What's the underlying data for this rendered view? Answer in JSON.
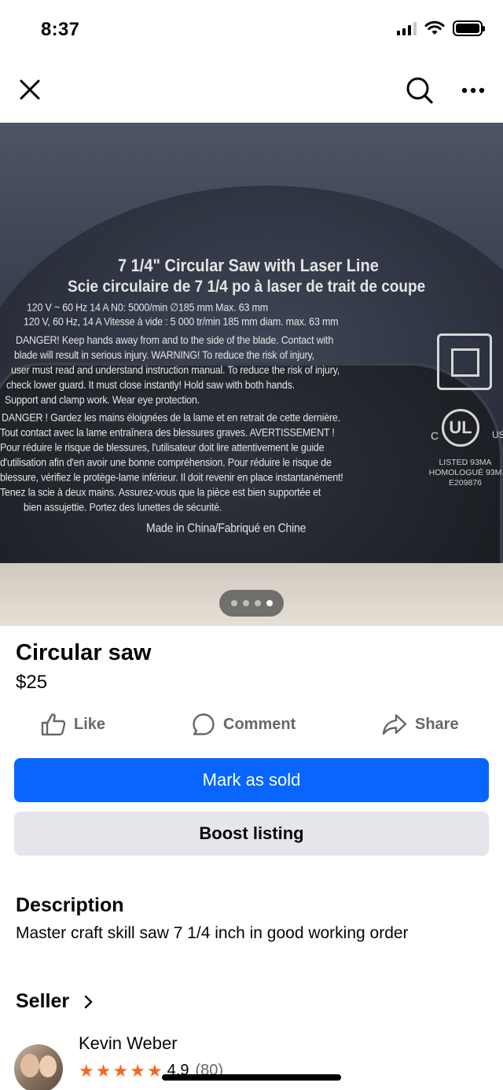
{
  "status_bar": {
    "time": "8:37"
  },
  "nav": {
    "close_icon": "close-icon",
    "search_icon": "search-icon",
    "more_icon": "more-icon"
  },
  "photo": {
    "label_lines": [
      "7 1/4\" Circular Saw with Laser Line",
      "Scie circulaire de 7 1/4 po à laser de trait de coupe",
      "120 V ~ 60 Hz 14 A    N0: 5000/min    ∅185 mm Max. 63 mm",
      "120 V, 60 Hz, 14 A  Vitesse à vide : 5 000 tr/min  185 mm diam. max. 63 mm",
      "DANGER! Keep hands away from and to the side of the blade. Contact with",
      "blade will result in serious injury. WARNING! To reduce the risk of injury,",
      "user must read and understand instruction manual. To reduce the risk of injury,",
      "check lower guard. It must close instantly! Hold saw with both hands.",
      "Support and clamp work. Wear eye protection.",
      "DANGER ! Gardez les mains éloignées de la lame et en retrait de cette dernière.",
      "Tout contact avec la lame entraînera des blessures graves. AVERTISSEMENT !",
      "Pour réduire le risque de blessures, l'utilisateur doit lire attentivement le guide",
      "d'utilisation afin d'en avoir une bonne compréhension. Pour réduire le risque de",
      "blessure, vérifiez le protège-lame inférieur. Il doit revenir en place instantanément!",
      "Tenez la scie à deux mains. Assurez-vous que la pièce est bien supportée et",
      "bien assujettie. Portez des lunettes de sécurité.",
      "Made in China/Fabriqué en Chine"
    ],
    "ul_mark": "UL",
    "ul_c": "C",
    "ul_us": "US",
    "listed_text": "LISTED 93MA\nHOMOLOGUÉ 93M\nE209876",
    "carousel": {
      "count": 4,
      "active_index": 3
    }
  },
  "listing": {
    "title": "Circular saw",
    "price": "$25"
  },
  "actions": {
    "like": "Like",
    "comment": "Comment",
    "share": "Share"
  },
  "buttons": {
    "mark_sold": "Mark as sold",
    "boost": "Boost listing"
  },
  "description": {
    "heading": "Description",
    "text": "Master craft skill saw 7 1/4 inch in good working order"
  },
  "seller": {
    "heading": "Seller",
    "name": "Kevin Weber",
    "stars": 5,
    "rating": "4.9",
    "reviews": "(80)"
  },
  "colors": {
    "primary_button": "#0866ff",
    "secondary_button": "#e4e6eb",
    "star": "#f26a1b",
    "muted_text": "#65676b"
  }
}
